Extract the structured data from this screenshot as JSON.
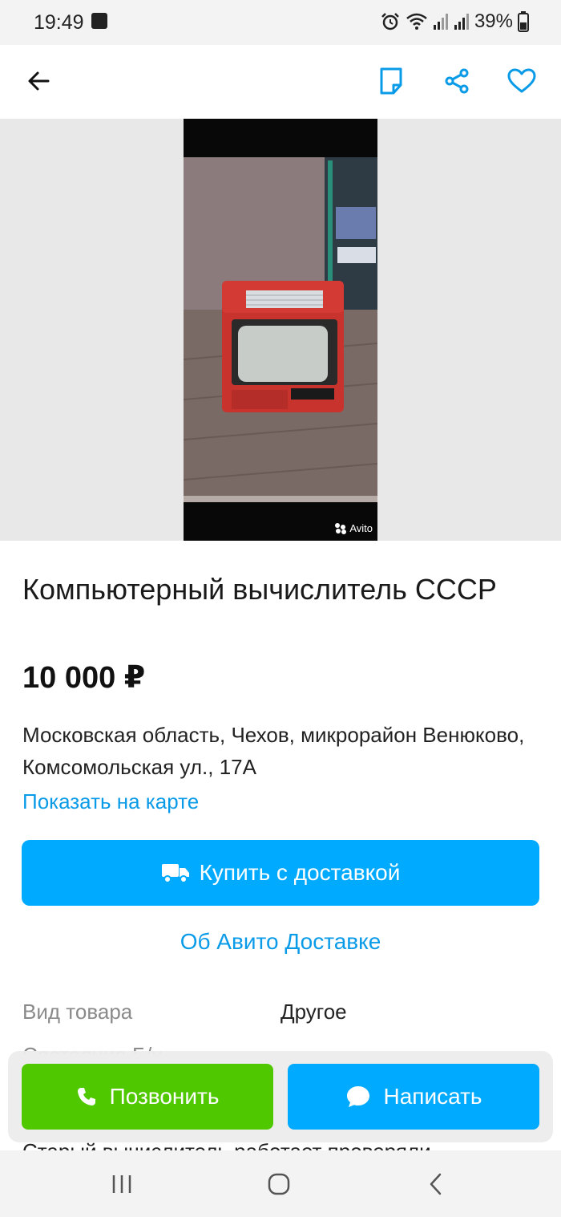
{
  "status_bar": {
    "time": "19:49",
    "battery_percent": "39%",
    "icons": [
      "image-icon",
      "alarm-icon",
      "wifi-icon",
      "signal-icon",
      "signal-icon",
      "battery-icon"
    ]
  },
  "app_bar": {
    "icons": [
      "back-arrow-icon",
      "note-icon",
      "share-icon",
      "heart-icon"
    ],
    "accent_color": "#0a9be8"
  },
  "gallery": {
    "watermark": "Avito"
  },
  "listing": {
    "title": "Компьютерный вычислитель СССР",
    "price": "10 000 ₽",
    "address": "Московская область, Чехов, микрорайон Венюково, Комсомольская ул., 17А",
    "map_link": "Показать на карте"
  },
  "delivery": {
    "buy_button": "Купить с доставкой",
    "info_link": "Об Авито Доставке",
    "button_color": "#00aaff"
  },
  "params": [
    {
      "label": "Вид товара",
      "value": "Другое"
    }
  ],
  "partial_row_text": "Состояние Б/у",
  "description_peek": "Старый вычислитель работает проверяли",
  "actions": {
    "call_label": "Позвонить",
    "message_label": "Написать",
    "call_color": "#4fc800",
    "message_color": "#00aaff"
  },
  "nav_bar": {
    "icons": [
      "recents-icon",
      "home-icon",
      "back-icon"
    ]
  }
}
